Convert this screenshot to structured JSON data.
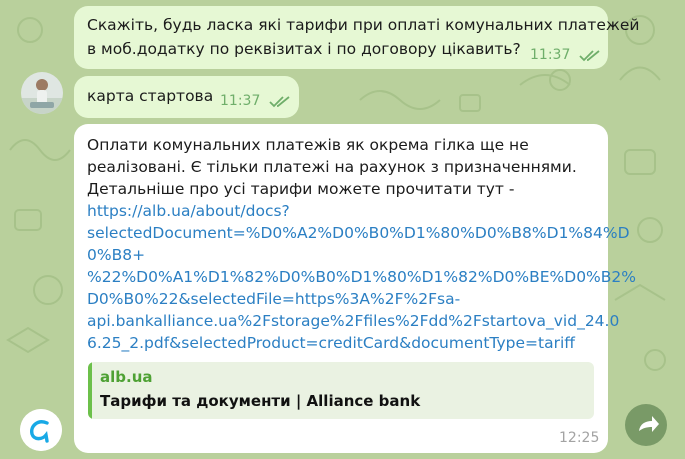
{
  "messages": {
    "out1": {
      "lines": [
        "Скажіть, будь ласка які тарифи при оплаті комунальних платежей",
        "в моб.додатку по реквізитах і по договору цікавить?"
      ],
      "time": "11:37"
    },
    "out2": {
      "text": "карта стартова",
      "time": "11:37"
    },
    "in1": {
      "lines": [
        "Оплати комунальних платежів як окрема гілка ще не",
        "реалізовані. Є тільки платежі на рахунок з призначеннями.",
        "Детальніше про усі тарифи можете прочитати тут -"
      ],
      "link_lines": [
        "https://alb.ua/about/docs?",
        "selectedDocument=%D0%A2%D0%B0%D1%80%D0%B8%D1%84%D",
        "0%B8+",
        "%22%D0%A1%D1%82%D0%B0%D1%80%D1%82%D0%BE%D0%B2%",
        "D0%B0%22&selectedFile=https%3A%2F%2Fsa-",
        "api.bankalliance.ua%2Fstorage%2Ffiles%2Fdd%2Fstartova_vid_24.0",
        "6.25_2.pdf&selectedProduct=creditCard&documentType=tariff"
      ],
      "preview": {
        "site": "alb.ua",
        "title": "Тарифи та документи | Alliance bank"
      },
      "time": "12:25"
    }
  },
  "icons": {
    "read": "double-check-icon",
    "share": "share-arrow-icon",
    "bank_avatar": "alliance-logo-icon",
    "user_avatar": "user-photo"
  },
  "colors": {
    "outgoing_bubble": "#e6f8d4",
    "incoming_bubble": "#ffffff",
    "link": "#2b7fc3",
    "accent_green": "#4ea134",
    "bank_logo": "#18a9e6"
  }
}
